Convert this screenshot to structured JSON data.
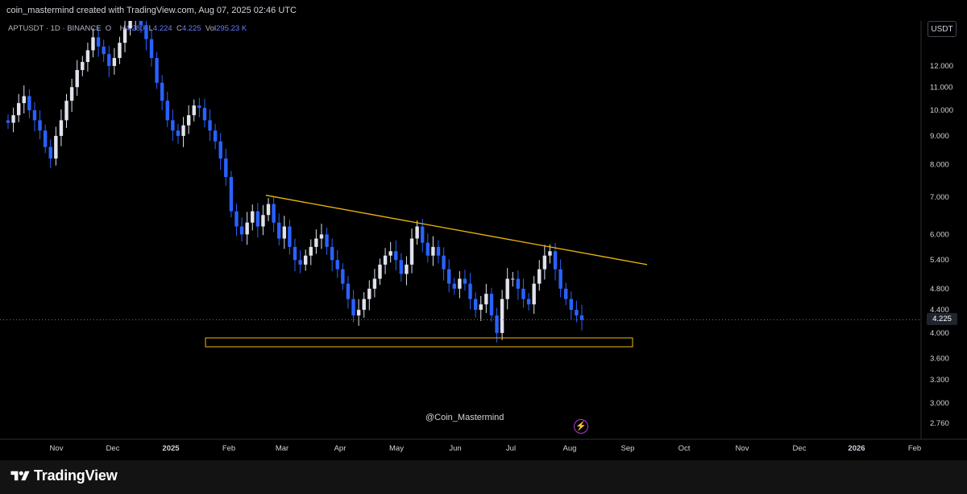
{
  "header": {
    "credit": "coin_mastermind created with TradingView.com, Aug 07, 2025 02:46 UTC"
  },
  "legend": {
    "symbol": "APTUSDT · 1D · BINANCE",
    "open_label": "O",
    "high_label": "H",
    "high_value": "4.280",
    "low_label": "L",
    "low_value": "4.224",
    "close_label": "C",
    "close_value": "4.225",
    "vol_label": "Vol",
    "vol_value": "295.23 K"
  },
  "currency_button": "USDT",
  "last_price": "4.225",
  "watermark": "@Coin_Mastermind",
  "footer": {
    "brand": "TradingView"
  },
  "colors": {
    "background": "#000000",
    "candle": "#e0e3eb",
    "candle_down": "#2962ff",
    "trendline": "#f0b90b",
    "support_box": "#f0b90b"
  },
  "chart_data": {
    "type": "candlestick",
    "title": "",
    "scale": "log",
    "price_ticks": [
      12.0,
      11.0,
      10.0,
      9.0,
      8.0,
      7.0,
      6.0,
      5.4,
      4.8,
      4.4,
      4.0,
      3.6,
      3.3,
      3.0,
      2.76
    ],
    "price_tick_labels": [
      "12.000",
      "11.000",
      "10.000",
      "9.000",
      "8.000",
      "7.000",
      "6.000",
      "5.400",
      "4.800",
      "4.400",
      "4.000",
      "3.600",
      "3.300",
      "3.000",
      "2.760"
    ],
    "time_ticks": [
      "Nov",
      "Dec",
      "2025",
      "Feb",
      "Mar",
      "Apr",
      "May",
      "Jun",
      "Jul",
      "Aug",
      "Sep",
      "Oct",
      "Nov",
      "Dec",
      "2026",
      "Feb"
    ],
    "close_series_approx": [
      9.5,
      9.8,
      10.3,
      10.6,
      10.0,
      9.6,
      9.2,
      8.6,
      8.2,
      9.0,
      9.6,
      10.4,
      11.0,
      11.8,
      12.2,
      12.8,
      13.5,
      13.0,
      12.6,
      12.0,
      12.4,
      13.2,
      14.0,
      14.5,
      15.0,
      14.2,
      13.4,
      12.4,
      11.2,
      10.4,
      9.6,
      9.2,
      9.0,
      9.4,
      9.8,
      10.2,
      10.1,
      9.6,
      9.2,
      8.8,
      8.2,
      7.6,
      6.6,
      6.2,
      6.0,
      6.3,
      6.6,
      6.2,
      6.5,
      6.8,
      6.3,
      5.9,
      6.2,
      5.7,
      5.4,
      5.3,
      5.5,
      5.7,
      5.9,
      6.0,
      5.7,
      5.4,
      5.2,
      4.9,
      4.6,
      4.3,
      4.4,
      4.6,
      4.8,
      5.0,
      5.3,
      5.5,
      5.6,
      5.4,
      5.1,
      5.3,
      5.9,
      6.2,
      5.8,
      5.5,
      5.7,
      5.5,
      5.2,
      4.9,
      4.8,
      5.0,
      4.9,
      4.6,
      4.4,
      4.5,
      4.7,
      4.3,
      4.0,
      4.6,
      5.0,
      5.0,
      4.8,
      4.6,
      4.5,
      4.9,
      5.2,
      5.5,
      5.6,
      5.2,
      4.8,
      4.6,
      4.4,
      4.3,
      4.22
    ],
    "trendline": {
      "start": [
        "2025-02-20",
        7.05
      ],
      "end": [
        "2025-09-10",
        5.3
      ]
    },
    "support_zone": {
      "from": "2025-01-25",
      "to": "2025-09-10",
      "low": 3.78,
      "high": 3.92
    },
    "current_price": 4.225
  }
}
